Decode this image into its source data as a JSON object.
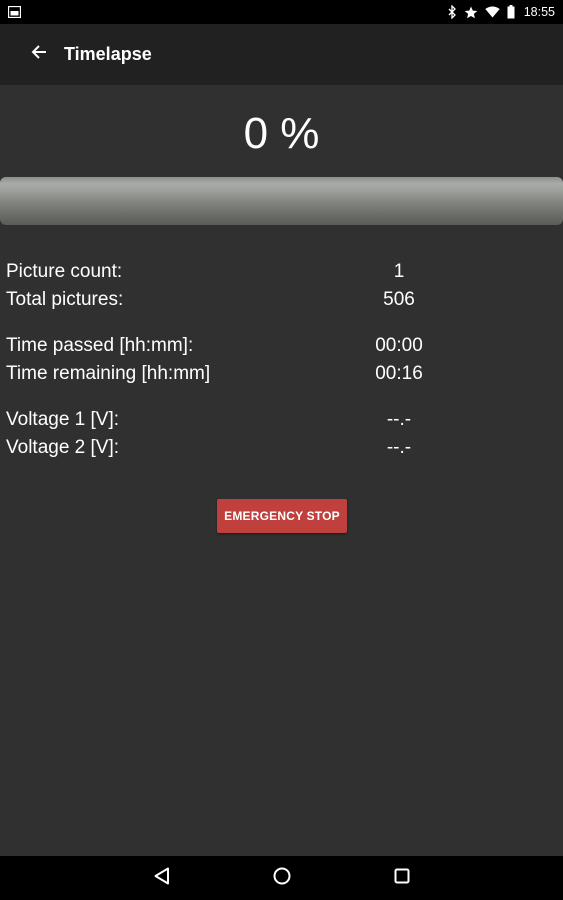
{
  "status_bar": {
    "time": "18:55",
    "icons": [
      "image-icon",
      "bluetooth-icon",
      "star-icon",
      "wifi-icon",
      "battery-icon"
    ]
  },
  "app_bar": {
    "title": "Timelapse",
    "back_icon": "arrow-back-icon"
  },
  "progress": {
    "percent_label": "0 %",
    "fraction": 0.0,
    "track_color": "#8c8f8b"
  },
  "info": {
    "picture_count_label": "Picture count:",
    "picture_count_value": "1",
    "total_pictures_label": "Total pictures:",
    "total_pictures_value": "506",
    "time_passed_label": "Time passed [hh:mm]:",
    "time_passed_value": "00:00",
    "time_remaining_label": "Time remaining [hh:mm]",
    "time_remaining_value": "00:16",
    "voltage1_label": "Voltage 1 [V]:",
    "voltage1_value": "--.-",
    "voltage2_label": "Voltage 2 [V]:",
    "voltage2_value": "--.-"
  },
  "emergency_button": {
    "label": "EMERGENCY STOP",
    "color": "#c0403d"
  },
  "nav_bar": {
    "icons": [
      "back-triangle-icon",
      "home-circle-icon",
      "recents-square-icon"
    ]
  },
  "colors": {
    "background": "#303030",
    "app_bar": "#212121",
    "status_bar": "#000000"
  }
}
